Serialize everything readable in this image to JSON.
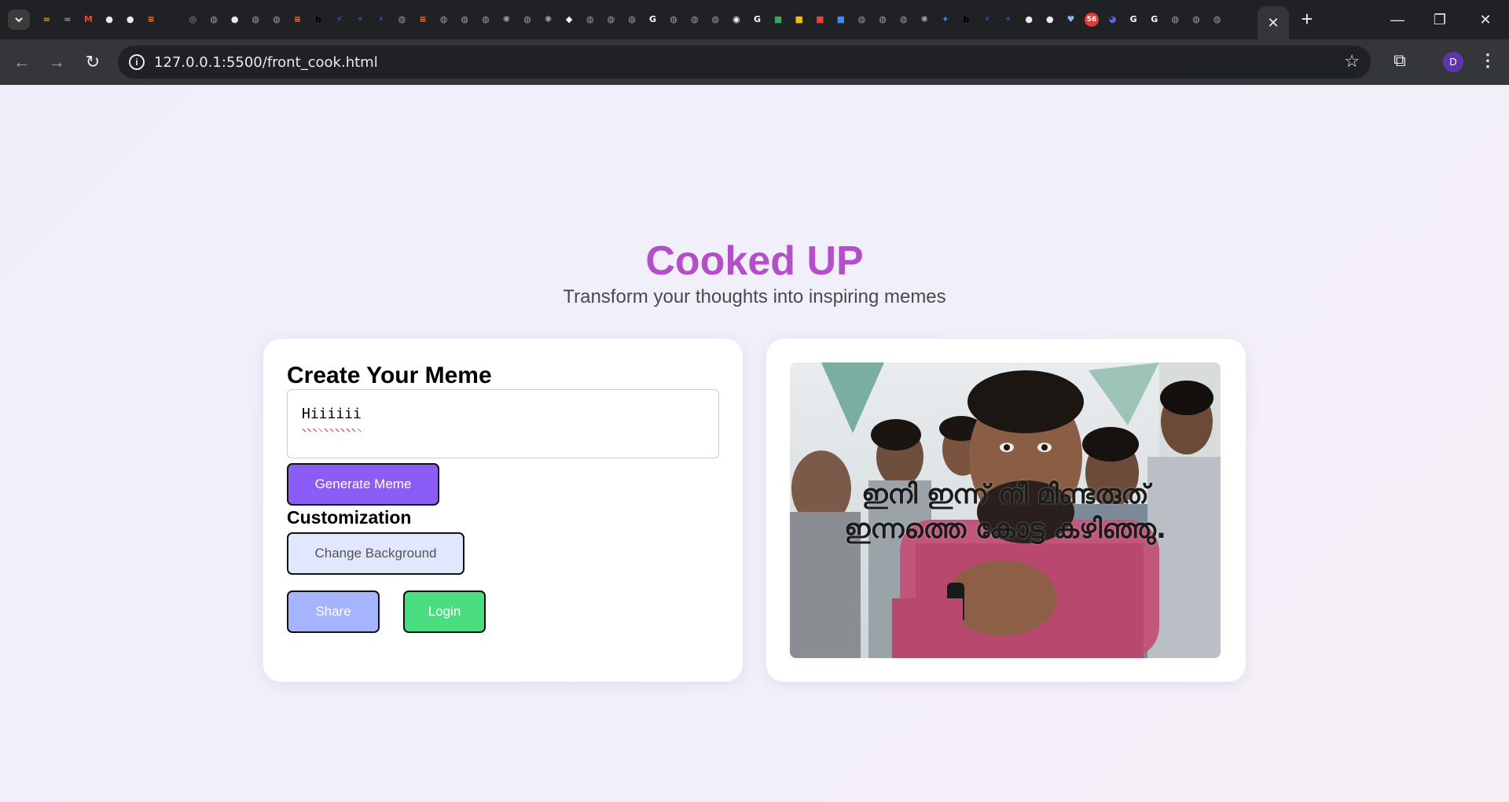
{
  "browser": {
    "active_tab_close": "✕",
    "new_tab": "+",
    "url": "127.0.0.1:5500/front_cook.html",
    "profile_initial": "D",
    "window_controls": {
      "minimize": "—",
      "restore": "❐",
      "close": "✕"
    },
    "tab_favicons": [
      {
        "name": "meta-icon",
        "color": "#f5a623",
        "glyph": "∞"
      },
      {
        "name": "meta-icon",
        "color": "#9aa0a6",
        "glyph": "∞"
      },
      {
        "name": "gmail-icon",
        "color": "#ea4335",
        "glyph": "M"
      },
      {
        "name": "github-icon",
        "color": "#e8eaed",
        "glyph": "●"
      },
      {
        "name": "github-icon",
        "color": "#e8eaed",
        "glyph": "●"
      },
      {
        "name": "stackoverflow-icon",
        "color": "#f48024",
        "glyph": "≡"
      },
      {
        "name": "viva-icon",
        "color": "#202124",
        "glyph": "v"
      },
      {
        "name": "chrome-icon",
        "color": "#9aa0a6",
        "glyph": "◎"
      },
      {
        "name": "globe-icon",
        "color": "#9aa0a6",
        "glyph": "◍"
      },
      {
        "name": "github-icon",
        "color": "#e8eaed",
        "glyph": "●"
      },
      {
        "name": "globe-icon",
        "color": "#9aa0a6",
        "glyph": "◍"
      },
      {
        "name": "globe-icon",
        "color": "#9aa0a6",
        "glyph": "◍"
      },
      {
        "name": "stackoverflow-icon",
        "color": "#f48024",
        "glyph": "≡"
      },
      {
        "name": "bolt-b-icon",
        "color": "#000000",
        "glyph": "b"
      },
      {
        "name": "bolt-icon",
        "color": "#1a73e8",
        "glyph": "⚡"
      },
      {
        "name": "bolt-icon",
        "color": "#1a73e8",
        "glyph": "⚡"
      },
      {
        "name": "bolt-icon",
        "color": "#1a73e8",
        "glyph": "⚡"
      },
      {
        "name": "globe-icon",
        "color": "#9aa0a6",
        "glyph": "◍"
      },
      {
        "name": "stackoverflow-icon",
        "color": "#f48024",
        "glyph": "≡"
      },
      {
        "name": "globe-icon",
        "color": "#9aa0a6",
        "glyph": "◍"
      },
      {
        "name": "globe-icon",
        "color": "#9aa0a6",
        "glyph": "◍"
      },
      {
        "name": "globe-icon",
        "color": "#9aa0a6",
        "glyph": "◍"
      },
      {
        "name": "openai-icon",
        "color": "#9aa0a6",
        "glyph": "✺"
      },
      {
        "name": "globe-icon",
        "color": "#9aa0a6",
        "glyph": "◍"
      },
      {
        "name": "openai-icon",
        "color": "#9aa0a6",
        "glyph": "✺"
      },
      {
        "name": "codepen-icon",
        "color": "#ffffff",
        "glyph": "◆"
      },
      {
        "name": "globe-icon",
        "color": "#9aa0a6",
        "glyph": "◍"
      },
      {
        "name": "globe-icon",
        "color": "#9aa0a6",
        "glyph": "◍"
      },
      {
        "name": "globe-icon",
        "color": "#9aa0a6",
        "glyph": "◍"
      },
      {
        "name": "google-icon",
        "color": "#ffffff",
        "glyph": "G"
      },
      {
        "name": "globe-icon",
        "color": "#9aa0a6",
        "glyph": "◍"
      },
      {
        "name": "globe-icon",
        "color": "#9aa0a6",
        "glyph": "◍"
      },
      {
        "name": "globe-icon",
        "color": "#9aa0a6",
        "glyph": "◍"
      },
      {
        "name": "steam-icon",
        "color": "#ffffff",
        "glyph": "◉"
      },
      {
        "name": "google-icon",
        "color": "#ffffff",
        "glyph": "G"
      },
      {
        "name": "colorful-icon",
        "color": "#34a853",
        "glyph": "■"
      },
      {
        "name": "colorful-icon",
        "color": "#fbbc04",
        "glyph": "■"
      },
      {
        "name": "colorful-icon",
        "color": "#ea4335",
        "glyph": "■"
      },
      {
        "name": "colorful-icon",
        "color": "#4285f4",
        "glyph": "■"
      },
      {
        "name": "globe-icon",
        "color": "#9aa0a6",
        "glyph": "◍"
      },
      {
        "name": "globe-icon",
        "color": "#9aa0a6",
        "glyph": "◍"
      },
      {
        "name": "globe-icon",
        "color": "#9aa0a6",
        "glyph": "◍"
      },
      {
        "name": "openai-icon",
        "color": "#9aa0a6",
        "glyph": "✺"
      },
      {
        "name": "gemini-icon",
        "color": "#4285f4",
        "glyph": "✦"
      },
      {
        "name": "bolt-b-icon",
        "color": "#000000",
        "glyph": "b"
      },
      {
        "name": "bolt-icon",
        "color": "#1a73e8",
        "glyph": "⚡"
      },
      {
        "name": "bolt-icon",
        "color": "#1a73e8",
        "glyph": "⚡"
      },
      {
        "name": "github-icon",
        "color": "#e8eaed",
        "glyph": "●"
      },
      {
        "name": "github-icon",
        "color": "#e8eaed",
        "glyph": "●"
      },
      {
        "name": "heart-icon",
        "color": "#8ab4f8",
        "glyph": "♥"
      },
      {
        "name": "notification-badge-icon",
        "color": "#5865f2",
        "glyph": "56"
      },
      {
        "name": "discord-icon",
        "color": "#5865f2",
        "glyph": "◕"
      },
      {
        "name": "google-icon",
        "color": "#ffffff",
        "glyph": "G"
      },
      {
        "name": "google-icon",
        "color": "#ffffff",
        "glyph": "G"
      },
      {
        "name": "globe-icon",
        "color": "#9aa0a6",
        "glyph": "◍"
      },
      {
        "name": "globe-icon",
        "color": "#9aa0a6",
        "glyph": "◍"
      },
      {
        "name": "globe-icon",
        "color": "#9aa0a6",
        "glyph": "◍"
      }
    ]
  },
  "page": {
    "title": "Cooked UP",
    "subtitle": "Transform your thoughts into inspiring memes",
    "colors": {
      "title": "#b54ec9",
      "generate": "#8b5cf6",
      "background_btn": "#e0e7ff",
      "share": "#a5b4fc",
      "login": "#4ade80"
    }
  },
  "editor": {
    "heading": "Create Your Meme",
    "input_value": "Hiiiiii",
    "generate_label": "Generate Meme",
    "customization_label": "Customization",
    "change_background_label": "Change Background",
    "share_label": "Share",
    "login_label": "Login"
  },
  "preview": {
    "caption_line1": "ഇനി ഇന്ന് നീ മിണ്ടരുത്",
    "caption_line2": "ഇന്നത്തെ കോട്ട കഴിഞ്ഞു."
  }
}
